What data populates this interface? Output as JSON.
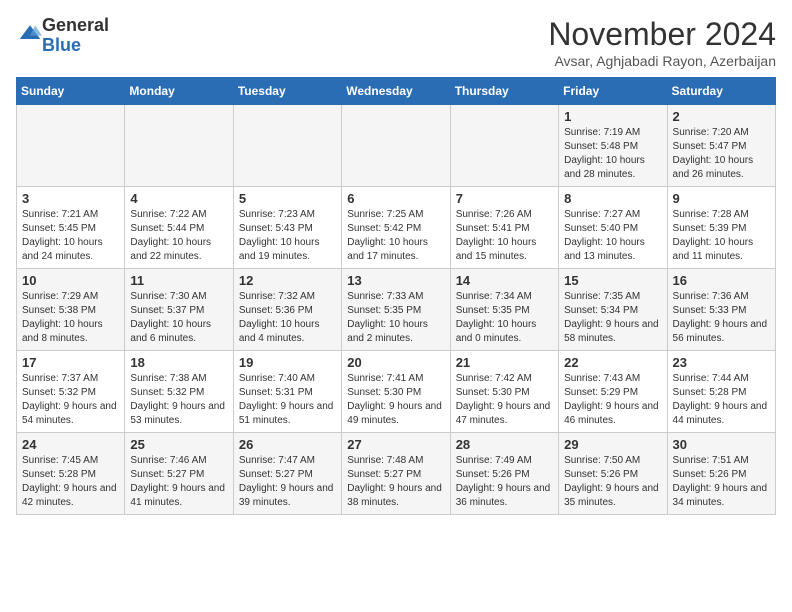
{
  "header": {
    "logo_general": "General",
    "logo_blue": "Blue",
    "month_title": "November 2024",
    "location": "Avsar, Aghjabadi Rayon, Azerbaijan"
  },
  "weekdays": [
    "Sunday",
    "Monday",
    "Tuesday",
    "Wednesday",
    "Thursday",
    "Friday",
    "Saturday"
  ],
  "weeks": [
    [
      {
        "day": "",
        "info": ""
      },
      {
        "day": "",
        "info": ""
      },
      {
        "day": "",
        "info": ""
      },
      {
        "day": "",
        "info": ""
      },
      {
        "day": "",
        "info": ""
      },
      {
        "day": "1",
        "info": "Sunrise: 7:19 AM\nSunset: 5:48 PM\nDaylight: 10 hours and 28 minutes."
      },
      {
        "day": "2",
        "info": "Sunrise: 7:20 AM\nSunset: 5:47 PM\nDaylight: 10 hours and 26 minutes."
      }
    ],
    [
      {
        "day": "3",
        "info": "Sunrise: 7:21 AM\nSunset: 5:45 PM\nDaylight: 10 hours and 24 minutes."
      },
      {
        "day": "4",
        "info": "Sunrise: 7:22 AM\nSunset: 5:44 PM\nDaylight: 10 hours and 22 minutes."
      },
      {
        "day": "5",
        "info": "Sunrise: 7:23 AM\nSunset: 5:43 PM\nDaylight: 10 hours and 19 minutes."
      },
      {
        "day": "6",
        "info": "Sunrise: 7:25 AM\nSunset: 5:42 PM\nDaylight: 10 hours and 17 minutes."
      },
      {
        "day": "7",
        "info": "Sunrise: 7:26 AM\nSunset: 5:41 PM\nDaylight: 10 hours and 15 minutes."
      },
      {
        "day": "8",
        "info": "Sunrise: 7:27 AM\nSunset: 5:40 PM\nDaylight: 10 hours and 13 minutes."
      },
      {
        "day": "9",
        "info": "Sunrise: 7:28 AM\nSunset: 5:39 PM\nDaylight: 10 hours and 11 minutes."
      }
    ],
    [
      {
        "day": "10",
        "info": "Sunrise: 7:29 AM\nSunset: 5:38 PM\nDaylight: 10 hours and 8 minutes."
      },
      {
        "day": "11",
        "info": "Sunrise: 7:30 AM\nSunset: 5:37 PM\nDaylight: 10 hours and 6 minutes."
      },
      {
        "day": "12",
        "info": "Sunrise: 7:32 AM\nSunset: 5:36 PM\nDaylight: 10 hours and 4 minutes."
      },
      {
        "day": "13",
        "info": "Sunrise: 7:33 AM\nSunset: 5:35 PM\nDaylight: 10 hours and 2 minutes."
      },
      {
        "day": "14",
        "info": "Sunrise: 7:34 AM\nSunset: 5:35 PM\nDaylight: 10 hours and 0 minutes."
      },
      {
        "day": "15",
        "info": "Sunrise: 7:35 AM\nSunset: 5:34 PM\nDaylight: 9 hours and 58 minutes."
      },
      {
        "day": "16",
        "info": "Sunrise: 7:36 AM\nSunset: 5:33 PM\nDaylight: 9 hours and 56 minutes."
      }
    ],
    [
      {
        "day": "17",
        "info": "Sunrise: 7:37 AM\nSunset: 5:32 PM\nDaylight: 9 hours and 54 minutes."
      },
      {
        "day": "18",
        "info": "Sunrise: 7:38 AM\nSunset: 5:32 PM\nDaylight: 9 hours and 53 minutes."
      },
      {
        "day": "19",
        "info": "Sunrise: 7:40 AM\nSunset: 5:31 PM\nDaylight: 9 hours and 51 minutes."
      },
      {
        "day": "20",
        "info": "Sunrise: 7:41 AM\nSunset: 5:30 PM\nDaylight: 9 hours and 49 minutes."
      },
      {
        "day": "21",
        "info": "Sunrise: 7:42 AM\nSunset: 5:30 PM\nDaylight: 9 hours and 47 minutes."
      },
      {
        "day": "22",
        "info": "Sunrise: 7:43 AM\nSunset: 5:29 PM\nDaylight: 9 hours and 46 minutes."
      },
      {
        "day": "23",
        "info": "Sunrise: 7:44 AM\nSunset: 5:28 PM\nDaylight: 9 hours and 44 minutes."
      }
    ],
    [
      {
        "day": "24",
        "info": "Sunrise: 7:45 AM\nSunset: 5:28 PM\nDaylight: 9 hours and 42 minutes."
      },
      {
        "day": "25",
        "info": "Sunrise: 7:46 AM\nSunset: 5:27 PM\nDaylight: 9 hours and 41 minutes."
      },
      {
        "day": "26",
        "info": "Sunrise: 7:47 AM\nSunset: 5:27 PM\nDaylight: 9 hours and 39 minutes."
      },
      {
        "day": "27",
        "info": "Sunrise: 7:48 AM\nSunset: 5:27 PM\nDaylight: 9 hours and 38 minutes."
      },
      {
        "day": "28",
        "info": "Sunrise: 7:49 AM\nSunset: 5:26 PM\nDaylight: 9 hours and 36 minutes."
      },
      {
        "day": "29",
        "info": "Sunrise: 7:50 AM\nSunset: 5:26 PM\nDaylight: 9 hours and 35 minutes."
      },
      {
        "day": "30",
        "info": "Sunrise: 7:51 AM\nSunset: 5:26 PM\nDaylight: 9 hours and 34 minutes."
      }
    ]
  ]
}
